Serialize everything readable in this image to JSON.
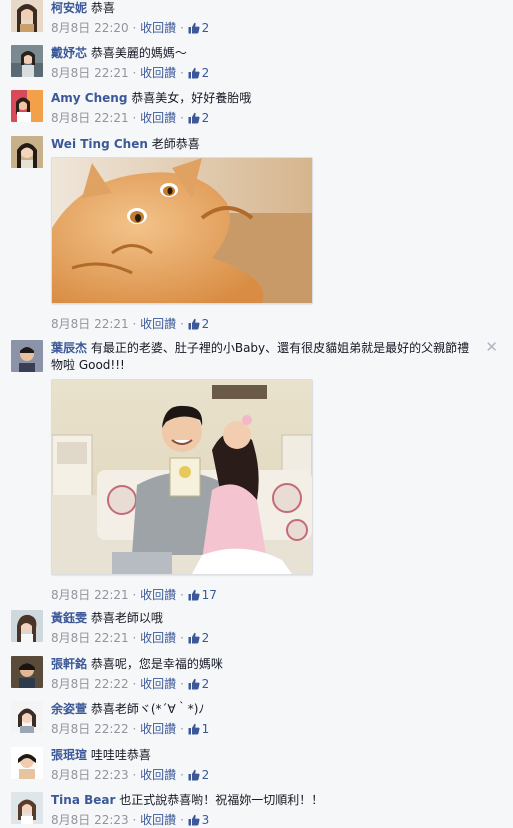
{
  "comments": [
    {
      "author": "柯安妮",
      "text": "恭喜",
      "date": "8月8日 22:20",
      "retract": "收回讚",
      "likes": "2"
    },
    {
      "author": "戴妤芯",
      "text": "恭喜美麗的媽媽～",
      "date": "8月8日 22:21",
      "retract": "收回讚",
      "likes": "2"
    },
    {
      "author": "Amy Cheng",
      "text": "恭喜美女，好好養胎哦",
      "date": "8月8日 22:21",
      "retract": "收回讚",
      "likes": "2"
    },
    {
      "author": "Wei Ting Chen",
      "text": "老師恭喜",
      "date": "8月8日 22:21",
      "retract": "收回讚",
      "likes": "2"
    },
    {
      "author": "葉辰杰",
      "text": "有最正的老婆、肚子裡的小Baby、還有很皮貓姐弟就是最好的父親節禮物啦 Good!!!",
      "date": "8月8日 22:21",
      "retract": "收回讚",
      "likes": "17"
    },
    {
      "author": "黃鈺雯",
      "text": "恭喜老師以哦",
      "date": "8月8日 22:21",
      "retract": "收回讚",
      "likes": "2"
    },
    {
      "author": "張軒銘",
      "text": "恭喜呢，您是幸福的媽咪",
      "date": "8月8日 22:22",
      "retract": "收回讚",
      "likes": "2"
    },
    {
      "author": "余姿萱",
      "text": "恭喜老師ヾ(*´∀｀*)ﾉ",
      "date": "8月8日 22:22",
      "retract": "收回讚",
      "likes": "1"
    },
    {
      "author": "張珉瑄",
      "text": "哇哇哇恭喜",
      "date": "8月8日 22:23",
      "retract": "收回讚",
      "likes": "2"
    },
    {
      "author": "Tina Bear",
      "text": "也正式說恭喜喲！祝福妳一切順利！！",
      "date": "8月8日 22:23",
      "retract": "收回讚",
      "likes": "3"
    }
  ],
  "separator": "·",
  "close_glyph": "✕",
  "icons": {
    "like": "thumbs-up-icon",
    "remove": "close-icon"
  },
  "colors": {
    "link": "#3b5998",
    "meta": "#90949c",
    "background": "#f6f7f9"
  }
}
